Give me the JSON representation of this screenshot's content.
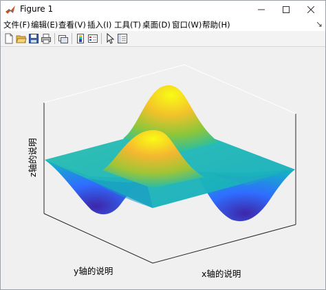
{
  "window": {
    "title": "Figure 1"
  },
  "menu": [
    "文件(F)",
    "编辑(E)",
    "查看(V)",
    "插入(I)",
    "工具(T)",
    "桌面(D)",
    "窗口(W)",
    "帮助(H)"
  ],
  "menu_right": "↘",
  "toolbar": [
    "new-figure-icon",
    "open-file-icon",
    "save-icon",
    "print-icon",
    "link-plot-icon",
    "insert-colorbar-icon",
    "insert-legend-icon",
    "edit-plot-icon",
    "property-inspector-icon"
  ],
  "plot": {
    "xlabel": "x轴的说明",
    "ylabel": "y轴的说明",
    "zlabel": "z轴的说明",
    "colormap": [
      "#3e26a8",
      "#2f6dff",
      "#12b1c9",
      "#3cc283",
      "#b2c12e",
      "#feb735",
      "#f9fb15"
    ]
  }
}
